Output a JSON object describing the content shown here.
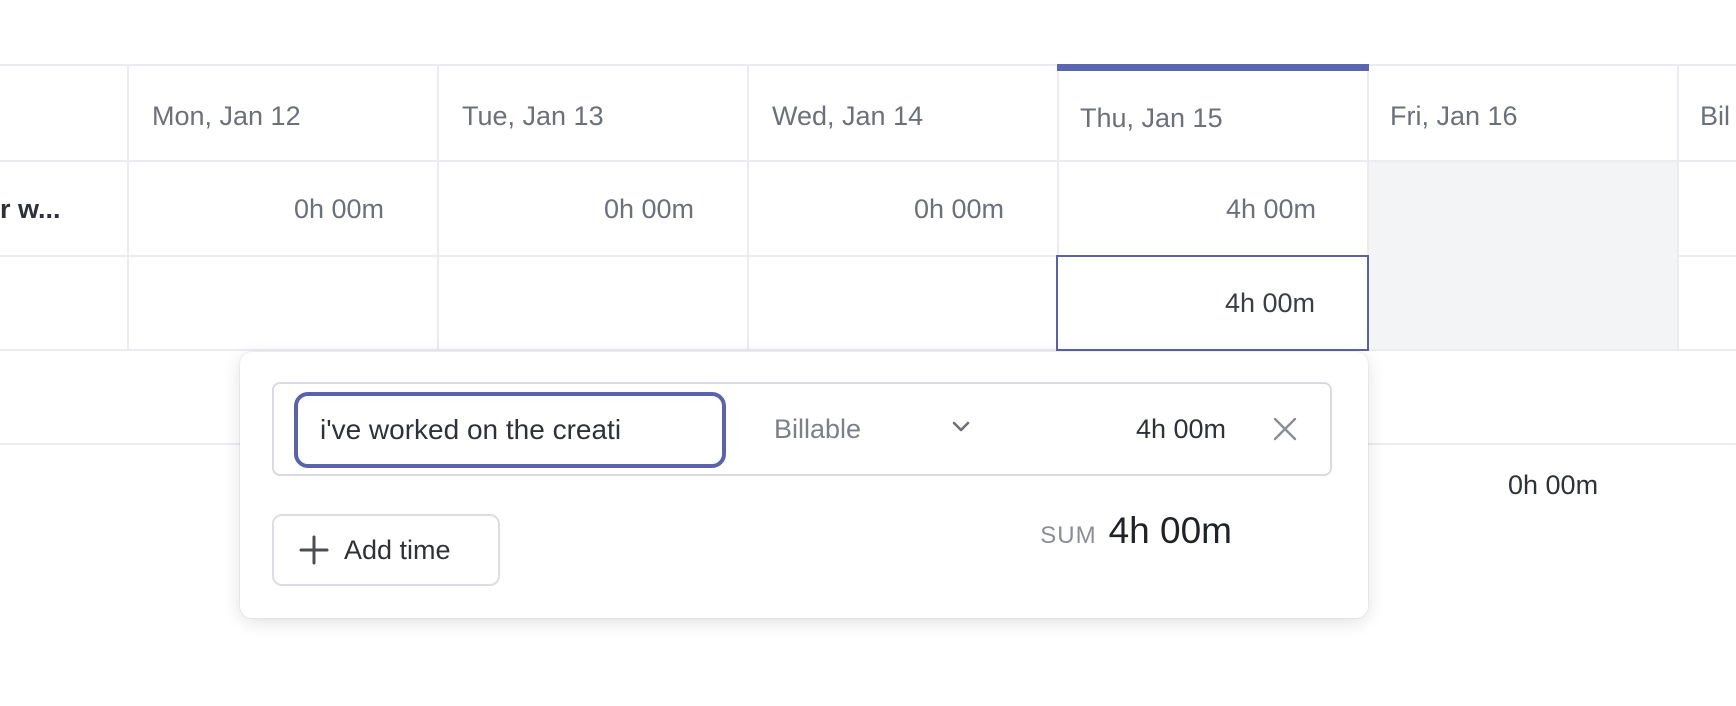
{
  "columns": [
    {
      "label": "Mon, Jan 12"
    },
    {
      "label": "Tue, Jan 13"
    },
    {
      "label": "Wed, Jan 14"
    },
    {
      "label": "Thu, Jan 15"
    },
    {
      "label": "Fri, Jan 16"
    },
    {
      "label": "Bil"
    }
  ],
  "active_column_label": "Thu, Jan 15",
  "accent_color": "#5b65b0",
  "row1": {
    "label": "r w...",
    "values": [
      "0h 00m",
      "0h 00m",
      "0h 00m",
      "4h 00m"
    ]
  },
  "row2": {
    "selected_value": "4h 00m"
  },
  "popover": {
    "description_value": "i've worked on the creati",
    "billing_value": "Billable",
    "entry_duration": "4h 00m",
    "add_time_label": "Add time",
    "sum_label": "SUM",
    "sum_value": "4h 00m"
  },
  "side_total": "0h 00m",
  "icons": {
    "chevron": "chevron-down-icon",
    "close": "close-icon",
    "plus": "plus-icon"
  }
}
